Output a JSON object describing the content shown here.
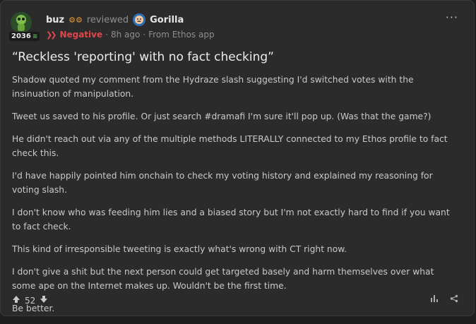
{
  "author": {
    "name": "buz",
    "score": "2036"
  },
  "review_header": {
    "verb": "reviewed",
    "subject": "Gorilla",
    "sentiment": "Negative",
    "separator": "·",
    "time": "8h ago",
    "source": "From Ethos app"
  },
  "review": {
    "title": "“Reckless 'reporting' with no fact checking”",
    "paragraphs": [
      "Shadow quoted my comment from the Hydraze slash suggesting I'd switched votes with the insinuation of manipulation.",
      "Tweet us saved to his profile. Or just search #dramafi I'm sure it'll pop up. (Was that the game?)",
      "He didn't reach out via any of the multiple methods LITERALLY connected to my Ethos profile to fact check this.",
      "I'd have happily pointed him onchain to check my voting history and explained my reasoning for voting slash.",
      "I don't know who was feeding him lies and a biased story but I'm not exactly hard to find if you want to fact check.",
      "This kind of irresponsible tweeting is exactly what's wrong with CT right now.",
      "I don't give a shit but the next person could get targeted basely and harm themselves over what some ape on the Internet makes up. Wouldn't be the first time.",
      "Be better."
    ]
  },
  "footer": {
    "votes": "52"
  },
  "icons": {
    "menu": "more-horizontal-icon",
    "upvote": "arrow-up-icon",
    "downvote": "arrow-down-icon",
    "stats": "bar-chart-icon",
    "share": "share-icon"
  },
  "colors": {
    "negative": "#e0474c",
    "badge": "#e59b2a",
    "background": "#2b2b2b"
  }
}
